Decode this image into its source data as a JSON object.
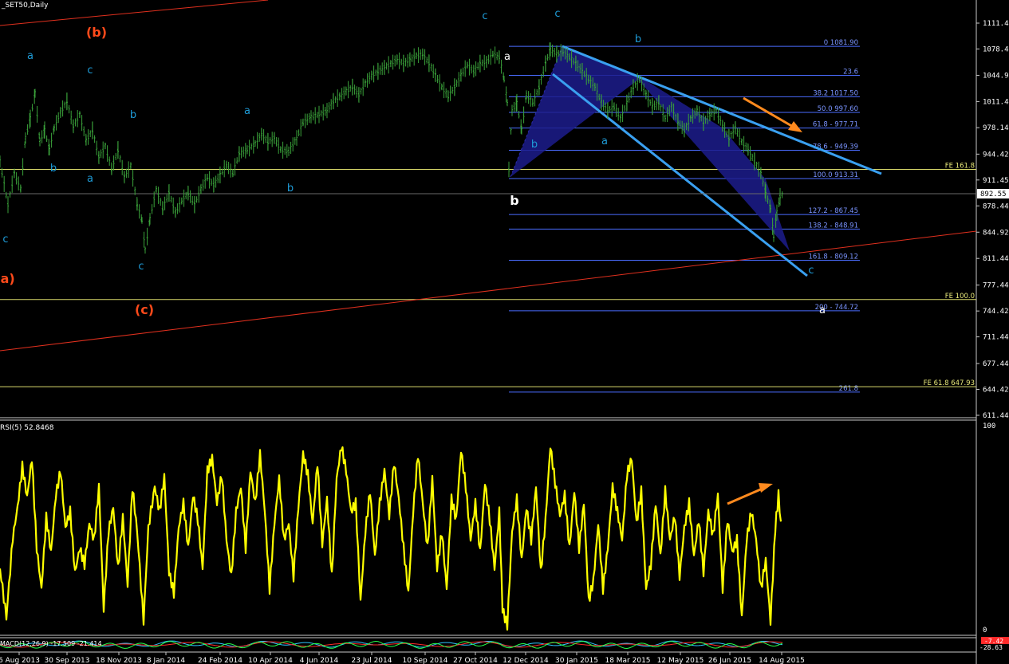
{
  "chart_data": [
    {
      "type": "line",
      "title": "_SET50,Daily",
      "price_axis_ticks": [
        1111.44,
        1078.49,
        1044.92,
        1011.44,
        978.14,
        944.42,
        911.45,
        878.44,
        844.92,
        811.44,
        777.44,
        744.42,
        711.44,
        677.44,
        644.42,
        611.44
      ],
      "current_price": "892.55",
      "ylim": [
        600,
        1140
      ],
      "date_ticks": [
        "6 Aug 2013",
        "30 Sep 2013",
        "18 Nov 2013",
        "8 Jan 2014",
        "24 Feb 2014",
        "10 Apr 2014",
        "4 Jun 2014",
        "23 Jul 2014",
        "10 Sep 2014",
        "27 Oct 2014",
        "12 Dec 2014",
        "30 Jan 2015",
        "18 Mar 2015",
        "12 May 2015",
        "26 Jun 2015",
        "14 Aug 2015"
      ],
      "price_series": [
        [
          0,
          935
        ],
        [
          10,
          880
        ],
        [
          18,
          920
        ],
        [
          26,
          900
        ],
        [
          32,
          965
        ],
        [
          38,
          990
        ],
        [
          44,
          1022
        ],
        [
          50,
          960
        ],
        [
          56,
          975
        ],
        [
          62,
          950
        ],
        [
          68,
          978
        ],
        [
          76,
          998
        ],
        [
          84,
          1012
        ],
        [
          92,
          980
        ],
        [
          100,
          995
        ],
        [
          108,
          962
        ],
        [
          116,
          975
        ],
        [
          124,
          940
        ],
        [
          132,
          955
        ],
        [
          140,
          925
        ],
        [
          148,
          950
        ],
        [
          156,
          915
        ],
        [
          164,
          930
        ],
        [
          172,
          880
        ],
        [
          178,
          860
        ],
        [
          182,
          822
        ],
        [
          188,
          862
        ],
        [
          196,
          900
        ],
        [
          204,
          875
        ],
        [
          212,
          895
        ],
        [
          220,
          870
        ],
        [
          228,
          885
        ],
        [
          236,
          895
        ],
        [
          244,
          880
        ],
        [
          252,
          900
        ],
        [
          260,
          915
        ],
        [
          268,
          905
        ],
        [
          276,
          918
        ],
        [
          284,
          930
        ],
        [
          292,
          920
        ],
        [
          300,
          945
        ],
        [
          310,
          950
        ],
        [
          320,
          958
        ],
        [
          328,
          970
        ],
        [
          336,
          960
        ],
        [
          344,
          965
        ],
        [
          352,
          950
        ],
        [
          362,
          948
        ],
        [
          372,
          965
        ],
        [
          380,
          985
        ],
        [
          390,
          992
        ],
        [
          400,
          995
        ],
        [
          410,
          1000
        ],
        [
          418,
          1012
        ],
        [
          426,
          1018
        ],
        [
          434,
          1025
        ],
        [
          442,
          1030
        ],
        [
          450,
          1020
        ],
        [
          458,
          1035
        ],
        [
          466,
          1045
        ],
        [
          474,
          1050
        ],
        [
          482,
          1055
        ],
        [
          490,
          1060
        ],
        [
          498,
          1065
        ],
        [
          506,
          1060
        ],
        [
          514,
          1065
        ],
        [
          522,
          1070
        ],
        [
          530,
          1072
        ],
        [
          538,
          1060
        ],
        [
          546,
          1045
        ],
        [
          554,
          1030
        ],
        [
          562,
          1018
        ],
        [
          570,
          1030
        ],
        [
          578,
          1045
        ],
        [
          586,
          1058
        ],
        [
          594,
          1050
        ],
        [
          602,
          1060
        ],
        [
          610,
          1062
        ],
        [
          618,
          1072
        ],
        [
          626,
          1068
        ],
        [
          632,
          1040
        ],
        [
          636,
          1010
        ],
        [
          638,
          925
        ],
        [
          642,
          1000
        ],
        [
          648,
          1010
        ],
        [
          654,
          975
        ],
        [
          660,
          1020
        ],
        [
          668,
          1010
        ],
        [
          676,
          1030
        ],
        [
          684,
          1060
        ],
        [
          690,
          1078
        ],
        [
          698,
          1072
        ],
        [
          706,
          1075
        ],
        [
          714,
          1068
        ],
        [
          722,
          1060
        ],
        [
          730,
          1050
        ],
        [
          738,
          1040
        ],
        [
          746,
          1030
        ],
        [
          754,
          1010
        ],
        [
          762,
          1000
        ],
        [
          770,
          1005
        ],
        [
          778,
          990
        ],
        [
          786,
          1010
        ],
        [
          794,
          1030
        ],
        [
          802,
          1040
        ],
        [
          810,
          1020
        ],
        [
          818,
          1005
        ],
        [
          826,
          1010
        ],
        [
          834,
          990
        ],
        [
          842,
          1005
        ],
        [
          850,
          985
        ],
        [
          858,
          975
        ],
        [
          866,
          990
        ],
        [
          874,
          1000
        ],
        [
          882,
          985
        ],
        [
          890,
          995
        ],
        [
          898,
          1000
        ],
        [
          906,
          980
        ],
        [
          914,
          965
        ],
        [
          922,
          978
        ],
        [
          930,
          960
        ],
        [
          938,
          950
        ],
        [
          946,
          935
        ],
        [
          954,
          920
        ],
        [
          960,
          895
        ],
        [
          966,
          875
        ],
        [
          970,
          840
        ],
        [
          974,
          870
        ],
        [
          978,
          890
        ],
        [
          981,
          893
        ]
      ],
      "fibonacci_levels": [
        {
          "label": "0  1081.90",
          "value": 1081.9
        },
        {
          "label": "23.6",
          "value": 1044.9
        },
        {
          "label": "38.2  1017.50",
          "value": 1017.5
        },
        {
          "label": "50.0  997.60",
          "value": 997.6
        },
        {
          "label": "61.8 - 977.71",
          "value": 977.71
        },
        {
          "label": "78.6 - 949.39",
          "value": 949.39
        },
        {
          "label": "100.0  913.31",
          "value": 913.31
        },
        {
          "label": "127.2 - 867.45",
          "value": 867.45
        },
        {
          "label": "138.2 - 848.91",
          "value": 848.91
        },
        {
          "label": "161.8 - 809.12",
          "value": 809.12
        },
        {
          "label": "200 - 744.72",
          "value": 744.72
        },
        {
          "label": "261.8",
          "value": 641.0
        }
      ],
      "fe_levels": [
        {
          "label": "FE 161.8",
          "value": 925
        },
        {
          "label": "FE 100.0",
          "value": 759
        },
        {
          "label": "FE 61.8  647.93",
          "value": 647.93
        }
      ],
      "wave_labels": [
        {
          "text": "(b)",
          "color": "#ff4a1a"
        },
        {
          "text": "(a)",
          "color": "#ff4a1a"
        },
        {
          "text": "(c)",
          "color": "#ff4a1a"
        },
        {
          "text": "a",
          "color": "#1e9bd7"
        },
        {
          "text": "c",
          "color": "#1e9bd7"
        },
        {
          "text": "b",
          "color": "#1e9bd7"
        },
        {
          "text": "b",
          "color": "#1e9bd7"
        },
        {
          "text": "a",
          "color": "#1e9bd7"
        },
        {
          "text": "c",
          "color": "#1e9bd7"
        },
        {
          "text": "a",
          "color": "#1e9bd7"
        },
        {
          "text": "c",
          "color": "#1e9bd7"
        },
        {
          "text": "b",
          "color": "#1e9bd7"
        },
        {
          "text": "c",
          "color": "#1e9bd7"
        },
        {
          "text": "c",
          "color": "#1e9bd7"
        },
        {
          "text": "a",
          "color": "#ffffff"
        },
        {
          "text": "b",
          "color": "#1e9bd7"
        },
        {
          "text": "b",
          "color": "#1e9bd7"
        },
        {
          "text": "a",
          "color": "#1e9bd7"
        },
        {
          "text": "b",
          "color": "#ffffff"
        },
        {
          "text": "c",
          "color": "#1e9bd7"
        },
        {
          "text": "a",
          "color": "#ffffff"
        }
      ],
      "colors": {
        "price": "#3aa13a",
        "rsi": "#ffff00",
        "fib": "#4a6cff",
        "fe": "#d8d86a",
        "trend_red": "#e0301e",
        "channel": "#3aa0f0",
        "arrow": "#ff8a1e",
        "pattern": "#1c1c8c"
      }
    },
    {
      "type": "line",
      "title": "RSI(5) 52.8468",
      "ylim": [
        0,
        100
      ],
      "axis_ticks": [
        "100",
        "0"
      ],
      "series": [
        [
          0,
          30
        ],
        [
          8,
          6
        ],
        [
          16,
          45
        ],
        [
          22,
          60
        ],
        [
          28,
          80
        ],
        [
          34,
          65
        ],
        [
          40,
          84
        ],
        [
          46,
          40
        ],
        [
          52,
          20
        ],
        [
          58,
          55
        ],
        [
          64,
          38
        ],
        [
          70,
          66
        ],
        [
          76,
          78
        ],
        [
          82,
          50
        ],
        [
          88,
          58
        ],
        [
          94,
          28
        ],
        [
          100,
          40
        ],
        [
          106,
          32
        ],
        [
          112,
          52
        ],
        [
          118,
          44
        ],
        [
          124,
          70
        ],
        [
          130,
          10
        ],
        [
          136,
          48
        ],
        [
          142,
          60
        ],
        [
          148,
          30
        ],
        [
          154,
          55
        ],
        [
          160,
          22
        ],
        [
          166,
          70
        ],
        [
          172,
          48
        ],
        [
          180,
          4
        ],
        [
          186,
          50
        ],
        [
          194,
          70
        ],
        [
          200,
          58
        ],
        [
          206,
          75
        ],
        [
          212,
          28
        ],
        [
          218,
          18
        ],
        [
          224,
          50
        ],
        [
          230,
          62
        ],
        [
          236,
          40
        ],
        [
          242,
          66
        ],
        [
          248,
          54
        ],
        [
          254,
          30
        ],
        [
          260,
          78
        ],
        [
          266,
          84
        ],
        [
          272,
          62
        ],
        [
          278,
          76
        ],
        [
          284,
          44
        ],
        [
          290,
          26
        ],
        [
          296,
          58
        ],
        [
          302,
          70
        ],
        [
          308,
          40
        ],
        [
          314,
          78
        ],
        [
          320,
          62
        ],
        [
          326,
          86
        ],
        [
          332,
          58
        ],
        [
          338,
          20
        ],
        [
          344,
          52
        ],
        [
          350,
          74
        ],
        [
          356,
          44
        ],
        [
          362,
          52
        ],
        [
          368,
          26
        ],
        [
          374,
          60
        ],
        [
          380,
          86
        ],
        [
          386,
          76
        ],
        [
          392,
          52
        ],
        [
          398,
          82
        ],
        [
          404,
          42
        ],
        [
          410,
          64
        ],
        [
          416,
          26
        ],
        [
          422,
          74
        ],
        [
          428,
          90
        ],
        [
          434,
          78
        ],
        [
          440,
          58
        ],
        [
          446,
          62
        ],
        [
          452,
          14
        ],
        [
          458,
          48
        ],
        [
          464,
          68
        ],
        [
          470,
          36
        ],
        [
          476,
          62
        ],
        [
          482,
          78
        ],
        [
          488,
          56
        ],
        [
          494,
          82
        ],
        [
          500,
          64
        ],
        [
          506,
          40
        ],
        [
          512,
          18
        ],
        [
          518,
          58
        ],
        [
          524,
          86
        ],
        [
          530,
          62
        ],
        [
          536,
          40
        ],
        [
          542,
          74
        ],
        [
          548,
          30
        ],
        [
          554,
          48
        ],
        [
          560,
          20
        ],
        [
          566,
          64
        ],
        [
          572,
          54
        ],
        [
          578,
          88
        ],
        [
          584,
          70
        ],
        [
          590,
          44
        ],
        [
          596,
          62
        ],
        [
          602,
          38
        ],
        [
          608,
          72
        ],
        [
          614,
          54
        ],
        [
          620,
          30
        ],
        [
          626,
          58
        ],
        [
          630,
          10
        ],
        [
          636,
          2
        ],
        [
          642,
          48
        ],
        [
          648,
          64
        ],
        [
          654,
          34
        ],
        [
          660,
          60
        ],
        [
          666,
          44
        ],
        [
          672,
          70
        ],
        [
          678,
          28
        ],
        [
          684,
          54
        ],
        [
          690,
          90
        ],
        [
          696,
          72
        ],
        [
          702,
          56
        ],
        [
          708,
          66
        ],
        [
          714,
          40
        ],
        [
          720,
          68
        ],
        [
          726,
          40
        ],
        [
          732,
          62
        ],
        [
          738,
          14
        ],
        [
          744,
          24
        ],
        [
          750,
          52
        ],
        [
          756,
          20
        ],
        [
          762,
          40
        ],
        [
          768,
          70
        ],
        [
          774,
          58
        ],
        [
          780,
          44
        ],
        [
          786,
          76
        ],
        [
          792,
          84
        ],
        [
          798,
          52
        ],
        [
          804,
          68
        ],
        [
          810,
          20
        ],
        [
          816,
          32
        ],
        [
          822,
          62
        ],
        [
          828,
          36
        ],
        [
          834,
          68
        ],
        [
          840,
          44
        ],
        [
          846,
          56
        ],
        [
          852,
          26
        ],
        [
          858,
          50
        ],
        [
          864,
          62
        ],
        [
          870,
          36
        ],
        [
          876,
          54
        ],
        [
          882,
          28
        ],
        [
          888,
          58
        ],
        [
          894,
          46
        ],
        [
          900,
          66
        ],
        [
          906,
          20
        ],
        [
          912,
          54
        ],
        [
          918,
          38
        ],
        [
          924,
          44
        ],
        [
          930,
          6
        ],
        [
          936,
          44
        ],
        [
          942,
          58
        ],
        [
          948,
          44
        ],
        [
          954,
          20
        ],
        [
          960,
          34
        ],
        [
          966,
          4
        ],
        [
          972,
          50
        ],
        [
          976,
          66
        ],
        [
          979,
          53
        ]
      ]
    },
    {
      "type": "line",
      "title": "MACD(12,26,9) -17.509 -21.414",
      "axis_ticks": [
        "-7.42",
        "-28.63"
      ]
    }
  ]
}
